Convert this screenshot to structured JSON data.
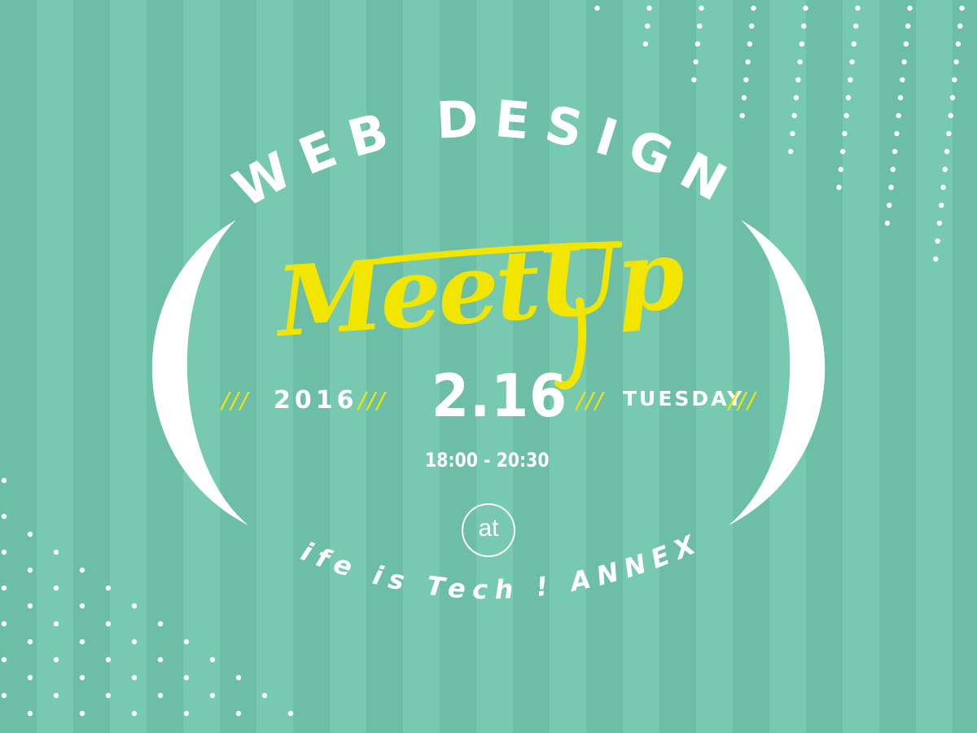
{
  "heading": "WEB DESIGN",
  "script_title": "MeetUp",
  "year": "2016",
  "date": "2.16",
  "weekday": "TUESDAY",
  "time_range": "18:00 - 20:30",
  "at_label": "at",
  "venue": "Life is Tech ! ANNEX",
  "slash_mark": "///",
  "colors": {
    "background_stripe_dark": "#6cbfa6",
    "background_stripe_light": "#77c9b0",
    "accent_yellow": "#f2e600",
    "text_white": "#ffffff"
  }
}
